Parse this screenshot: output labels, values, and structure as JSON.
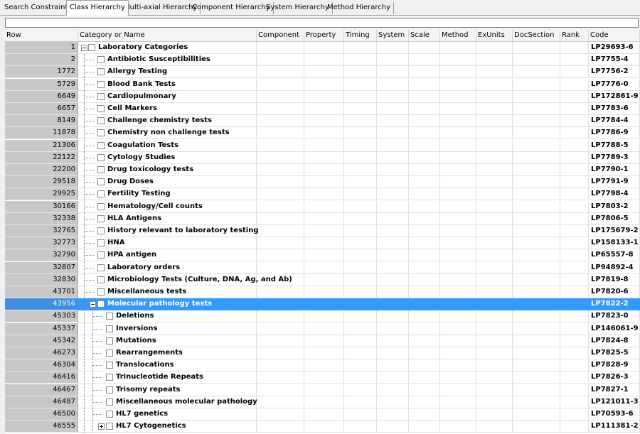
{
  "tabs": [
    "Search Constraints",
    "Class Hierarchy",
    "Multi-axial Hierarchy",
    "Component Hierarchy",
    "System Hierarchy",
    "Method Hierarchy"
  ],
  "active_tab": "Class Hierarchy",
  "search": {
    "value": ""
  },
  "columns": [
    "Row",
    "Category or Name",
    "Component",
    "Property",
    "Timing",
    "System",
    "Scale",
    "Method",
    "ExUnits",
    "DocSection",
    "Rank",
    "Code"
  ],
  "rows": [
    {
      "row": "1",
      "name": "Laboratory Categories",
      "code": "LP29693-6",
      "level": 0,
      "expander": "-"
    },
    {
      "row": "2",
      "name": "Antibiotic Susceptibilities",
      "code": "LP7755-4",
      "level": 1
    },
    {
      "row": "1772",
      "name": "Allergy Testing",
      "code": "LP7756-2",
      "level": 1
    },
    {
      "row": "5729",
      "name": "Blood Bank Tests",
      "code": "LP7776-0",
      "level": 1
    },
    {
      "row": "6649",
      "name": "Cardiopulmonary",
      "code": "LP172861-9",
      "level": 1
    },
    {
      "row": "6657",
      "name": "Cell Markers",
      "code": "LP7783-6",
      "level": 1
    },
    {
      "row": "8149",
      "name": "Challenge chemistry tests",
      "code": "LP7784-4",
      "level": 1
    },
    {
      "row": "11878",
      "name": "Chemistry non challenge tests",
      "code": "LP7786-9",
      "level": 1
    },
    {
      "row": "21306",
      "name": "Coagulation Tests",
      "code": "LP7788-5",
      "level": 1
    },
    {
      "row": "22122",
      "name": "Cytology Studies",
      "code": "LP7789-3",
      "level": 1
    },
    {
      "row": "22200",
      "name": "Drug toxicology tests",
      "code": "LP7790-1",
      "level": 1
    },
    {
      "row": "29518",
      "name": "Drug Doses",
      "code": "LP7791-9",
      "level": 1
    },
    {
      "row": "29925",
      "name": "Fertility Testing",
      "code": "LP7798-4",
      "level": 1
    },
    {
      "row": "30166",
      "name": "Hematology/Cell counts",
      "code": "LP7803-2",
      "level": 1
    },
    {
      "row": "32338",
      "name": "HLA Antigens",
      "code": "LP7806-5",
      "level": 1
    },
    {
      "row": "32765",
      "name": "History relevant to laboratory testing",
      "code": "LP175679-2",
      "level": 1
    },
    {
      "row": "32773",
      "name": "HNA",
      "code": "LP158133-1",
      "level": 1
    },
    {
      "row": "32790",
      "name": "HPA antigen",
      "code": "LP65557-8",
      "level": 1
    },
    {
      "row": "32807",
      "name": "Laboratory orders",
      "code": "LP94892-4",
      "level": 1
    },
    {
      "row": "32830",
      "name": "Microbiology Tests (Culture, DNA, Ag, and Ab)",
      "code": "LP7819-8",
      "level": 1
    },
    {
      "row": "43701",
      "name": "Miscellaneous tests",
      "code": "LP7820-6",
      "level": 1
    },
    {
      "row": "43956",
      "name": "Molecular pathology tests",
      "code": "LP7822-2",
      "level": 1,
      "expander": "-",
      "selected": true
    },
    {
      "row": "45303",
      "name": "Deletions",
      "code": "LP7823-0",
      "level": 2
    },
    {
      "row": "45337",
      "name": "Inversions",
      "code": "LP146061-9",
      "level": 2
    },
    {
      "row": "45342",
      "name": "Mutations",
      "code": "LP7824-8",
      "level": 2
    },
    {
      "row": "46273",
      "name": "Rearrangements",
      "code": "LP7825-5",
      "level": 2
    },
    {
      "row": "46304",
      "name": "Translocations",
      "code": "LP7828-9",
      "level": 2
    },
    {
      "row": "46416",
      "name": "Trinucleotide Repeats",
      "code": "LP7826-3",
      "level": 2
    },
    {
      "row": "46467",
      "name": "Trisomy repeats",
      "code": "LP7827-1",
      "level": 2
    },
    {
      "row": "46487",
      "name": "Miscellaneous molecular pathology",
      "code": "LP121011-3",
      "level": 2
    },
    {
      "row": "46500",
      "name": "HL7 genetics",
      "code": "LP70593-6",
      "level": 2
    },
    {
      "row": "46555",
      "name": "HL7 Cytogenetics",
      "code": "LP111381-2",
      "level": 2,
      "expander": "+"
    }
  ],
  "colors": {
    "selection": "#3399ff",
    "row_header": "#c8c8c8"
  }
}
